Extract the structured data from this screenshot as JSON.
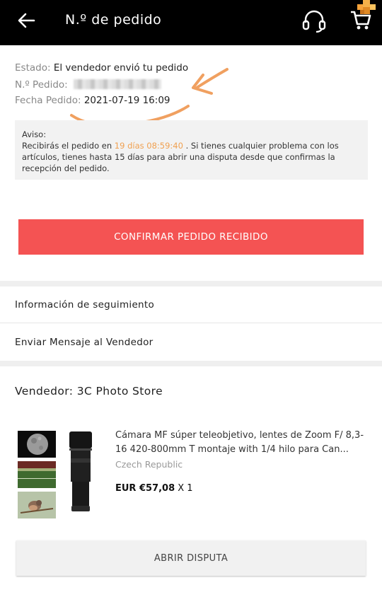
{
  "header": {
    "title": "N.º de pedido",
    "back_icon": "arrow-left-icon",
    "support_icon": "headset-icon",
    "cart_icon": "cart-icon"
  },
  "order": {
    "estado_label": "Estado:",
    "estado_value": "El vendedor envió tu pedido",
    "pedido_label": "N.º Pedido:",
    "fecha_label": "Fecha Pedido:",
    "fecha_value": "2021-07-19 16:09"
  },
  "notice": {
    "title": "Aviso:",
    "text_before": "Recibirás el pedido en ",
    "countdown": "19 días 08:59:40",
    "text_after": " . Si tienes cualquier problema con los artículos, tienes hasta 15 días para abrir una disputa desde que confirmas la recepción del pedido."
  },
  "actions": {
    "confirm_label": "CONFIRMAR PEDIDO RECIBIDO",
    "dispute_label": "ABRIR DISPUTA"
  },
  "menu": {
    "tracking": "Información de seguimiento",
    "message": "Enviar Mensaje al Vendedor"
  },
  "seller": {
    "label": "Vendedor: 3C Photo Store"
  },
  "product": {
    "title": "Cámara MF súper teleobjetivo, lentes de Zoom F/ 8,3-16 420-800mm T montaje with 1/4 hilo para Can...",
    "origin": "Czech Republic",
    "price": "EUR €57,08",
    "quantity": " X 1"
  },
  "colors": {
    "topbar": "#000000",
    "confirm": "#f45353",
    "highlight": "#f0a050",
    "annotation": "#f0a060"
  }
}
